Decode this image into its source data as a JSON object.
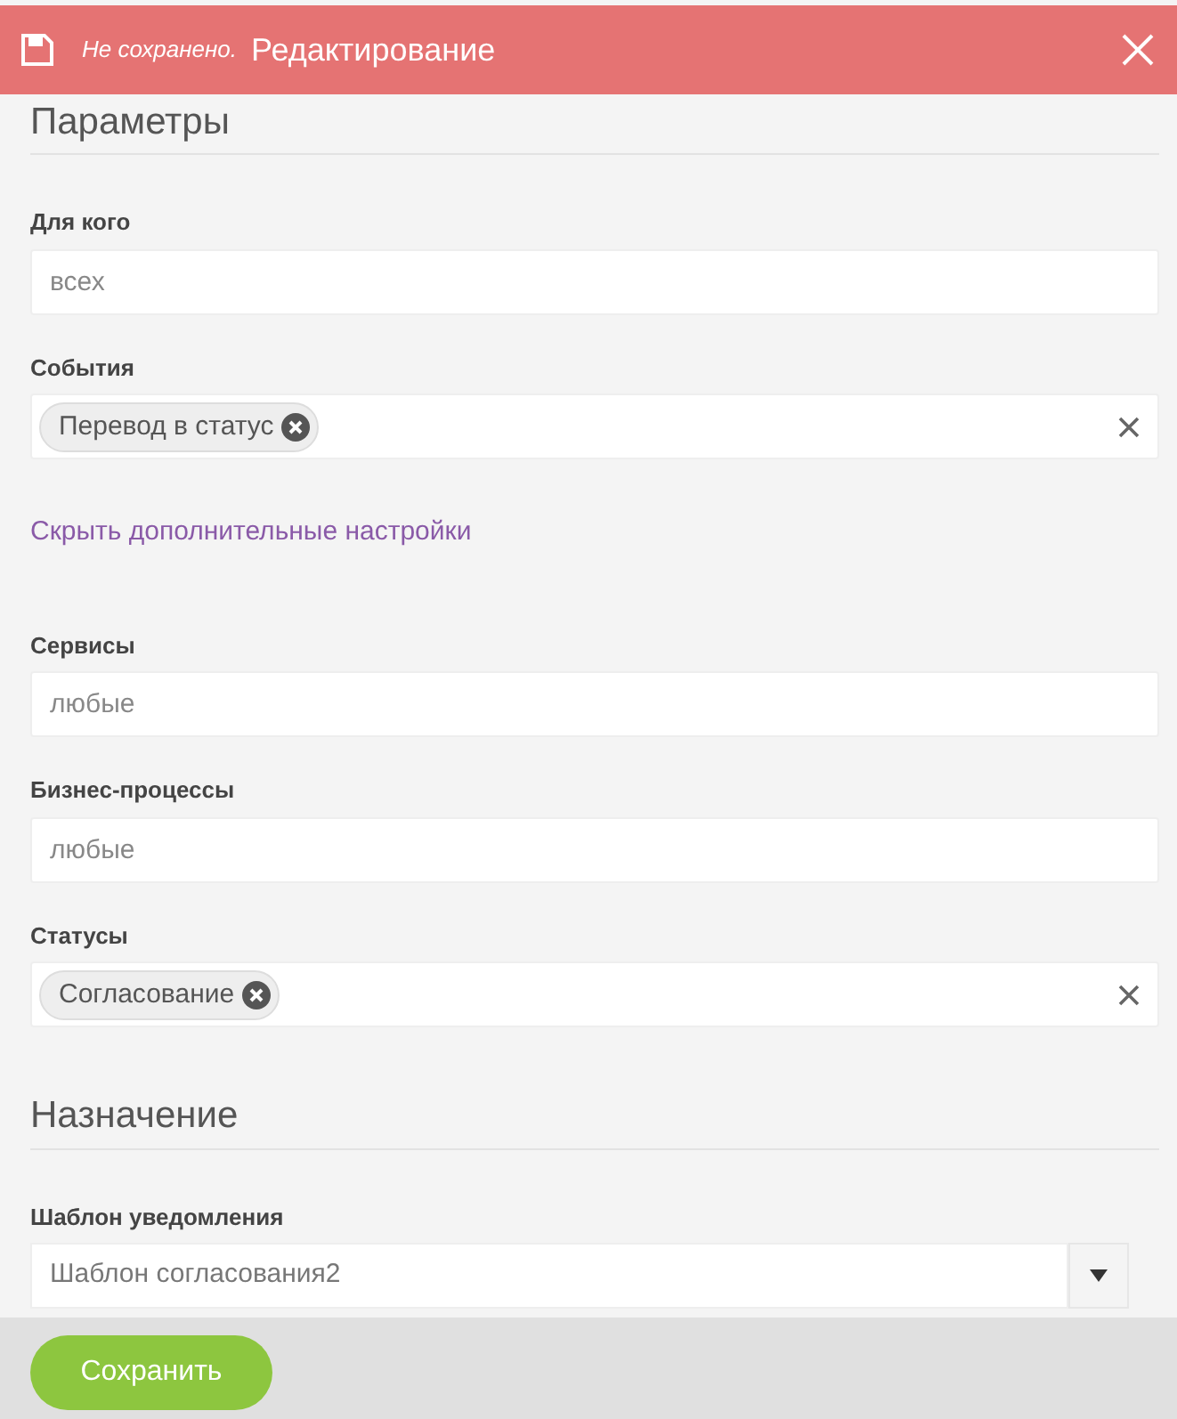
{
  "header": {
    "status": "Не сохранено.",
    "title": "Редактирование"
  },
  "sections": [
    {
      "title": "Параметры",
      "items": [
        {
          "kind": "field",
          "label": "Для кого",
          "placeholder": "всех"
        },
        {
          "kind": "tags",
          "label": "События",
          "tags": [
            "Перевод в статус"
          ]
        },
        {
          "kind": "link",
          "text": "Скрыть дополнительные настройки"
        },
        {
          "kind": "field",
          "label": "Сервисы",
          "placeholder": "любые"
        },
        {
          "kind": "field",
          "label": "Бизнес-процессы",
          "placeholder": "любые"
        },
        {
          "kind": "tags",
          "label": "Статусы",
          "tags": [
            "Согласование"
          ]
        }
      ]
    },
    {
      "title": "Назначение",
      "items": [
        {
          "kind": "select",
          "label": "Шаблон уведомления",
          "value": "Шаблон согласования2"
        }
      ]
    }
  ],
  "footer": {
    "save_button": "Сохранить"
  }
}
